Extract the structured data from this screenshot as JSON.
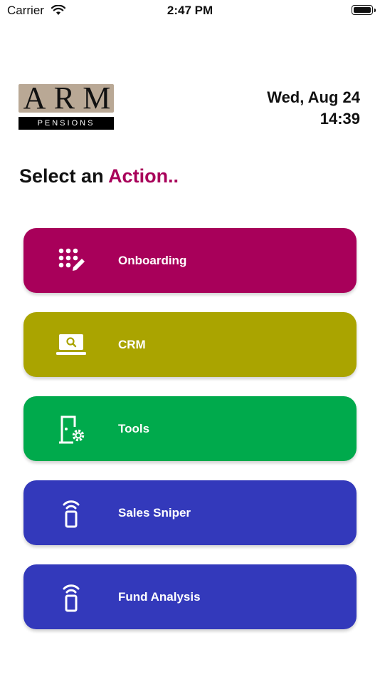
{
  "status_bar": {
    "carrier": "Carrier",
    "time": "2:47 PM"
  },
  "logo": {
    "letters": [
      "A",
      "R",
      "M"
    ],
    "subtitle": "PENSIONS"
  },
  "date": {
    "day": "Wed, Aug 24",
    "time": "14:39"
  },
  "heading": {
    "prefix": "Select an",
    "accent": "Action.."
  },
  "actions": [
    {
      "label": "Onboarding",
      "color": "#a8005a",
      "icon": "keypad-edit-icon"
    },
    {
      "label": "CRM",
      "color": "#aaa400",
      "icon": "laptop-search-icon"
    },
    {
      "label": "Tools",
      "color": "#00aa4c",
      "icon": "door-gear-icon"
    },
    {
      "label": "Sales Sniper",
      "color": "#3339bb",
      "icon": "phone-signal-icon"
    },
    {
      "label": "Fund Analysis",
      "color": "#3339bb",
      "icon": "phone-signal-icon"
    }
  ]
}
